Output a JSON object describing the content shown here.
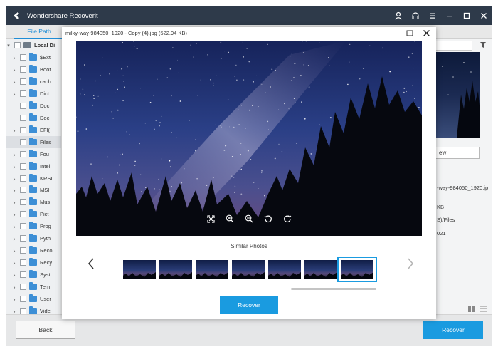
{
  "app": {
    "title": "Wondershare Recoverit",
    "icons": [
      "account-icon",
      "support-icon",
      "menu-icon",
      "minimize-icon",
      "maximize-icon",
      "close-icon"
    ]
  },
  "tabs": {
    "file_path": "File Path"
  },
  "tree": {
    "root": "Local Di",
    "items": [
      {
        "label": "$Ext",
        "expandable": true
      },
      {
        "label": "Boot",
        "expandable": true
      },
      {
        "label": "cach",
        "expandable": true
      },
      {
        "label": "Dict",
        "expandable": true
      },
      {
        "label": "Doc",
        "expandable": false
      },
      {
        "label": "Doc",
        "expandable": false
      },
      {
        "label": "EFI(",
        "expandable": true
      },
      {
        "label": "Files",
        "expandable": false,
        "selected": true
      },
      {
        "label": "Fou",
        "expandable": true
      },
      {
        "label": "Intel",
        "expandable": true
      },
      {
        "label": "KRSI",
        "expandable": true
      },
      {
        "label": "MSI",
        "expandable": true
      },
      {
        "label": "Mus",
        "expandable": true
      },
      {
        "label": "Pict",
        "expandable": true
      },
      {
        "label": "Prog",
        "expandable": true
      },
      {
        "label": "Pyth",
        "expandable": true
      },
      {
        "label": "Reco",
        "expandable": true
      },
      {
        "label": "Recy",
        "expandable": true
      },
      {
        "label": "Syst",
        "expandable": true
      },
      {
        "label": "Tem",
        "expandable": true
      },
      {
        "label": "User",
        "expandable": true
      },
      {
        "label": "Vide",
        "expandable": true
      }
    ]
  },
  "right_panel": {
    "view_button": "ew",
    "filename": "-way-984050_1920.jp",
    "size": "KB",
    "path": "S)/Files",
    "date": "021"
  },
  "modal": {
    "title": "milky-way-984050_1920 - Copy (4).jpg (522.94 KB)",
    "similar_label": "Similar Photos",
    "recover_label": "Recover",
    "zoom_icons": [
      "fit-screen-icon",
      "zoom-in-icon",
      "zoom-out-icon",
      "rotate-left-icon",
      "rotate-right-icon"
    ],
    "thumbnail_count": 7,
    "selected_thumbnail": 7
  },
  "bottom": {
    "back_label": "Back",
    "recover_label": "Recover"
  },
  "colors": {
    "titlebar": "#2e3a4a",
    "accent": "#1a9be0",
    "tab_accent": "#1f8dd6",
    "night_sky": "#1c2e66"
  }
}
